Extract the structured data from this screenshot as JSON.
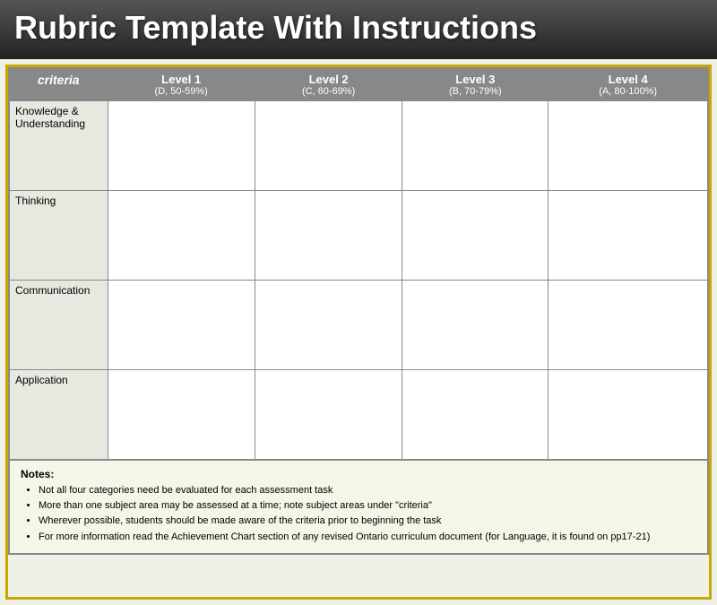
{
  "title": "Rubric Template With Instructions",
  "table": {
    "headers": {
      "criteria": "criteria",
      "level1": {
        "title": "Level 1",
        "range": "(D, 50-59%)"
      },
      "level2": {
        "title": "Level 2",
        "range": "(C, 60-69%)"
      },
      "level3": {
        "title": "Level 3",
        "range": "(B, 70-79%)"
      },
      "level4": {
        "title": "Level 4",
        "range": "(A, 80-100%)"
      }
    },
    "rows": [
      {
        "criteria": "Knowledge & Understanding",
        "cells": [
          "",
          "",
          "",
          ""
        ]
      },
      {
        "criteria": "Thinking",
        "cells": [
          "",
          "",
          "",
          ""
        ]
      },
      {
        "criteria": "Communication",
        "cells": [
          "",
          "",
          "",
          ""
        ]
      },
      {
        "criteria": "Application",
        "cells": [
          "",
          "",
          "",
          ""
        ]
      }
    ]
  },
  "notes": {
    "title": "Notes:",
    "items": [
      "Not all four categories need be evaluated for each assessment task",
      "More than one subject area may be assessed at a time; note subject areas under \"criteria\"",
      "Wherever possible, students should be made aware of the criteria prior to beginning the task",
      "For more information read the Achievement Chart section of any revised Ontario curriculum document (for Language, it is found on pp17-21)"
    ]
  }
}
